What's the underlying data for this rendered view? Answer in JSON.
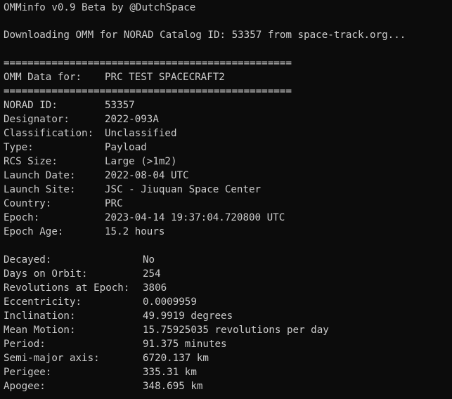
{
  "terminal": {
    "header": "OMMinfo v0.9 Beta by @DutchSpace",
    "downloading": "Downloading OMM for NORAD Catalog ID: 53357 from space-track.org...",
    "separator": "================================================",
    "omm_for_label": "OMM Data for:",
    "omm_for_value": "PRC TEST SPACECRAFT2",
    "block1": [
      {
        "label": "NORAD ID:",
        "value": "53357"
      },
      {
        "label": "Designator:",
        "value": "2022-093A"
      },
      {
        "label": "Classification:",
        "value": "Unclassified"
      },
      {
        "label": "Type:",
        "value": "Payload"
      },
      {
        "label": "RCS Size:",
        "value": "Large (>1m2)"
      },
      {
        "label": "Launch Date:",
        "value": "2022-08-04 UTC"
      },
      {
        "label": "Launch Site:",
        "value": "JSC - Jiuquan Space Center"
      },
      {
        "label": "Country:",
        "value": "PRC"
      },
      {
        "label": "Epoch:",
        "value": "2023-04-14 19:37:04.720800 UTC"
      },
      {
        "label": "Epoch Age:",
        "value": "15.2 hours"
      }
    ],
    "block2": [
      {
        "label": "Decayed:",
        "value": "No"
      },
      {
        "label": "Days on Orbit:",
        "value": "254"
      },
      {
        "label": "Revolutions at Epoch:",
        "value": "3806"
      },
      {
        "label": "Eccentricity:",
        "value": "0.0009959"
      },
      {
        "label": "Inclination:",
        "value": "49.9919 degrees"
      },
      {
        "label": "Mean Motion:",
        "value": "15.75925035 revolutions per day"
      },
      {
        "label": "Period:",
        "value": "91.375 minutes"
      },
      {
        "label": "Semi-major axis:",
        "value": "6720.137 km"
      },
      {
        "label": "Perigee:",
        "value": "335.31 km"
      },
      {
        "label": "Apogee:",
        "value": "348.695 km"
      }
    ]
  }
}
